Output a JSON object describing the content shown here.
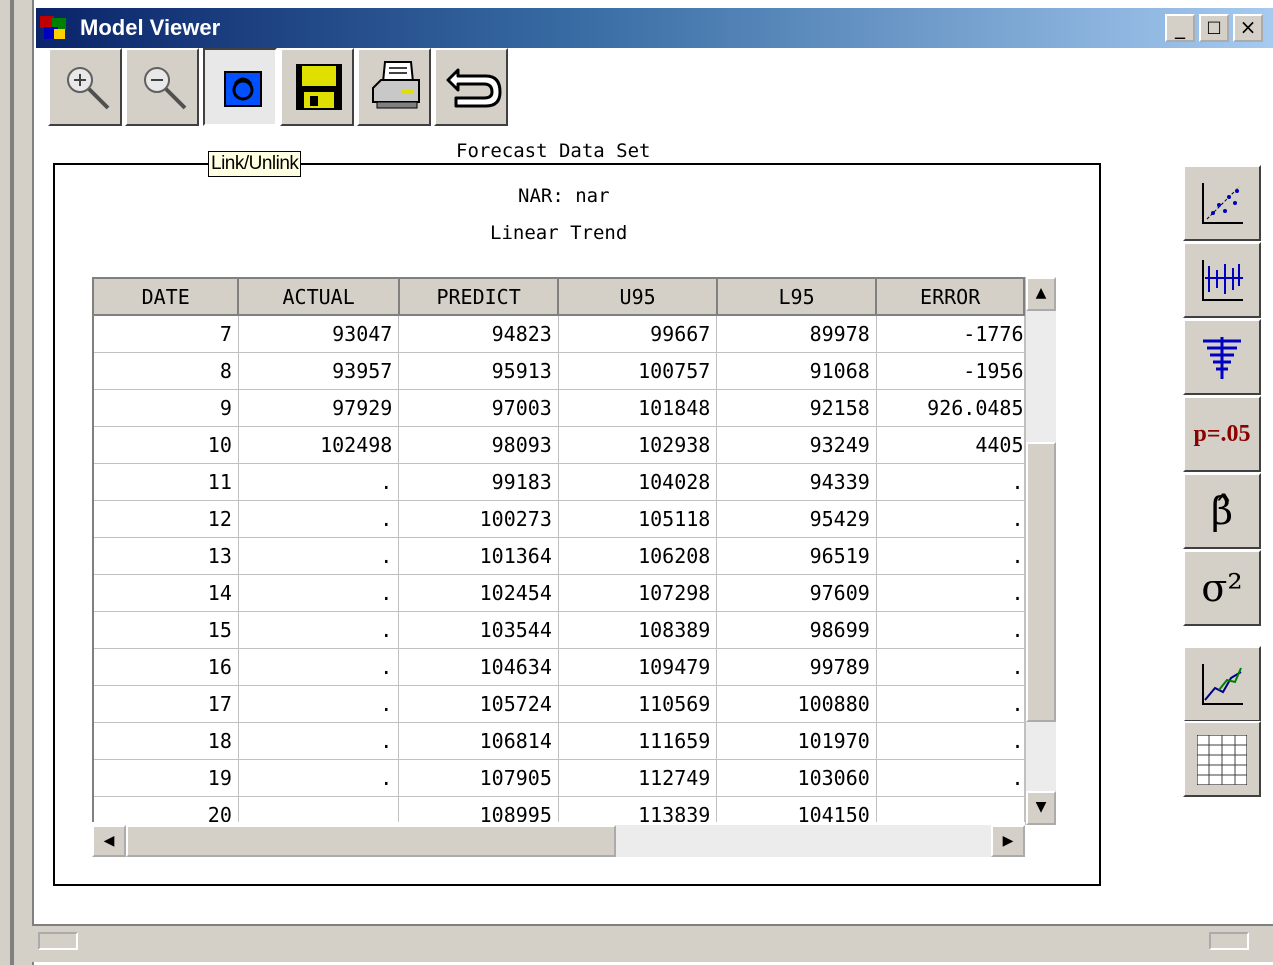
{
  "window": {
    "title": "Model Viewer",
    "minimize": "_",
    "maximize": "□",
    "close": "×"
  },
  "toolbar": {
    "buttons": [
      {
        "name": "zoom-in",
        "icon": "zoom-in-icon"
      },
      {
        "name": "zoom-out",
        "icon": "zoom-out-icon"
      },
      {
        "name": "link-unlink",
        "icon": "link-icon",
        "pressed": true
      },
      {
        "name": "save",
        "icon": "floppy-disk-icon"
      },
      {
        "name": "print",
        "icon": "printer-icon"
      },
      {
        "name": "return",
        "icon": "return-arrow-icon"
      }
    ],
    "tooltip": "Link/Unlink"
  },
  "panel": {
    "title": "Forecast Data Set",
    "subtitle1": "NAR: nar",
    "subtitle2": "Linear Trend"
  },
  "table": {
    "columns": [
      "DATE",
      "ACTUAL",
      "PREDICT",
      "U95",
      "L95",
      "ERROR"
    ],
    "rows": [
      [
        "7",
        "93047",
        "94823",
        "99667",
        "89978",
        "-1776"
      ],
      [
        "8",
        "93957",
        "95913",
        "100757",
        "91068",
        "-1956"
      ],
      [
        "9",
        "97929",
        "97003",
        "101848",
        "92158",
        "926.0485"
      ],
      [
        "10",
        "102498",
        "98093",
        "102938",
        "93249",
        "4405"
      ],
      [
        "11",
        ".",
        "99183",
        "104028",
        "94339",
        "."
      ],
      [
        "12",
        ".",
        "100273",
        "105118",
        "95429",
        "."
      ],
      [
        "13",
        ".",
        "101364",
        "106208",
        "96519",
        "."
      ],
      [
        "14",
        ".",
        "102454",
        "107298",
        "97609",
        "."
      ],
      [
        "15",
        ".",
        "103544",
        "108389",
        "98699",
        "."
      ],
      [
        "16",
        ".",
        "104634",
        "109479",
        "99789",
        "."
      ],
      [
        "17",
        ".",
        "105724",
        "110569",
        "100880",
        "."
      ],
      [
        "18",
        ".",
        "106814",
        "111659",
        "101970",
        "."
      ],
      [
        "19",
        ".",
        "107905",
        "112749",
        "103060",
        "."
      ],
      [
        "20",
        "",
        "108995",
        "113839",
        "104150",
        ""
      ]
    ]
  },
  "right_toolbar": {
    "buttons": [
      {
        "name": "scatter",
        "icon": "scatter-plot-icon"
      },
      {
        "name": "error-bars",
        "icon": "error-bars-icon"
      },
      {
        "name": "funnel",
        "icon": "funnel-lines-icon"
      },
      {
        "name": "significance",
        "label": "p=.05"
      },
      {
        "name": "beta-hat",
        "label": "β̂"
      },
      {
        "name": "sigma-squared",
        "label": "σ²"
      },
      {
        "name": "line-chart",
        "icon": "line-chart-icon"
      },
      {
        "name": "data-table",
        "icon": "table-grid-icon"
      }
    ]
  },
  "colors": {
    "title_gradient_start": "#0a246a",
    "title_gradient_end": "#a6caf0",
    "button_face": "#d4d0c8",
    "tooltip_bg": "#ffffe1",
    "p_value_text": "#8b0000"
  }
}
